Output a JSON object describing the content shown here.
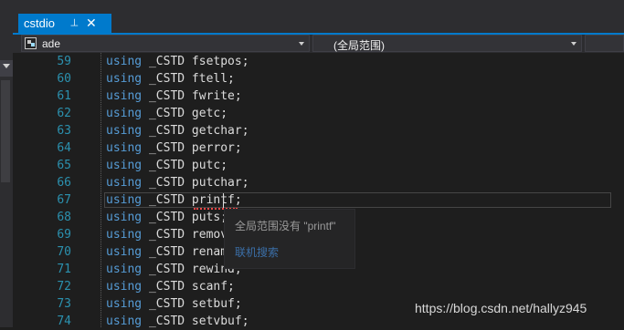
{
  "tab": {
    "title": "cstdio",
    "pin_glyph": "⊣",
    "close_glyph": "✕"
  },
  "nav": {
    "project": "ade",
    "scope": "(全局范围)"
  },
  "code_lines": [
    {
      "number": "59",
      "keyword": "using",
      "text": " _CSTD fsetpos;"
    },
    {
      "number": "60",
      "keyword": "using",
      "text": " _CSTD ftell;"
    },
    {
      "number": "61",
      "keyword": "using",
      "text": " _CSTD fwrite;"
    },
    {
      "number": "62",
      "keyword": "using",
      "text": " _CSTD getc;"
    },
    {
      "number": "63",
      "keyword": "using",
      "text": " _CSTD getchar;"
    },
    {
      "number": "64",
      "keyword": "using",
      "text": " _CSTD perror;"
    },
    {
      "number": "65",
      "keyword": "using",
      "text": " _CSTD putc;"
    },
    {
      "number": "66",
      "keyword": "using",
      "text": " _CSTD putchar;"
    },
    {
      "number": "67",
      "keyword": "using",
      "text": " _CSTD printf;"
    },
    {
      "number": "68",
      "keyword": "using",
      "text": " _CSTD puts;"
    },
    {
      "number": "69",
      "keyword": "using",
      "text": " _CSTD remove;"
    },
    {
      "number": "70",
      "keyword": "using",
      "text": " _CSTD rename;"
    },
    {
      "number": "71",
      "keyword": "using",
      "text": " _CSTD rewind;"
    },
    {
      "number": "72",
      "keyword": "using",
      "text": " _CSTD scanf;"
    },
    {
      "number": "73",
      "keyword": "using",
      "text": " _CSTD setbuf;"
    },
    {
      "number": "74",
      "keyword": "using",
      "text": " _CSTD setvbuf;"
    }
  ],
  "current_line": "67",
  "tooltip": {
    "message": "全局范围没有 \"printf\"",
    "link": "联机搜索"
  },
  "watermark": "https://blog.csdn.net/hallyz945",
  "colors": {
    "accent": "#007acc",
    "keyword": "#569cd6",
    "line_number": "#2b91af",
    "error": "#f44747"
  }
}
